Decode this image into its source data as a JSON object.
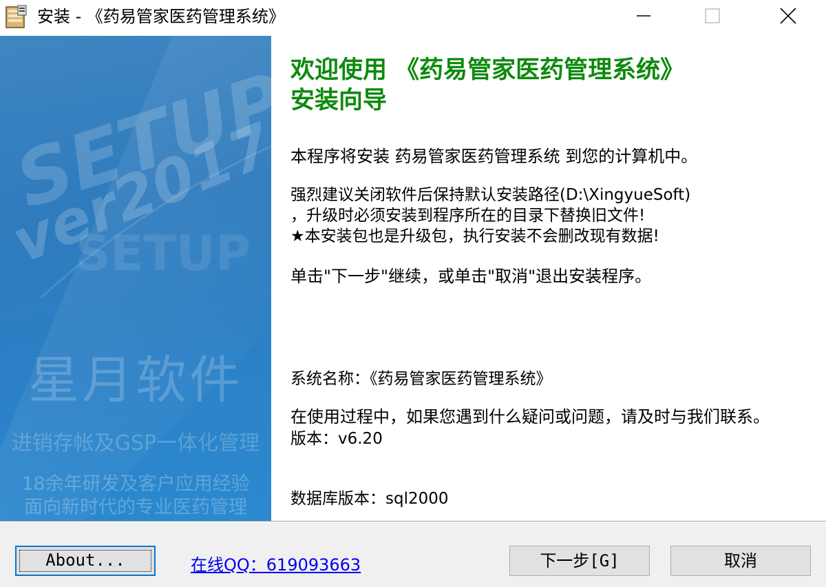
{
  "window": {
    "title": "安装 - 《药易管家医药管理系统》",
    "icon": "installer-box-icon",
    "controls": {
      "minimize": "minimize-icon",
      "maximize": "maximize-icon",
      "close": "close-icon"
    }
  },
  "banner": {
    "setup_text": "SETUP",
    "version_text": "ver2017",
    "setup_shadow_text": "SETUP",
    "brand": "星月软件",
    "tagline": "进销存帐及GSP一体化管理",
    "line1": "18余年研发及客户应用经验",
    "line2": "面向新时代的专业医药管理"
  },
  "content": {
    "welcome_line1": "欢迎使用 《药易管家医药管理系统》",
    "welcome_line2": "安装向导",
    "paragraph1": "本程序将安装 药易管家医药管理系统 到您的计算机中。",
    "paragraph2": "强烈建议关闭软件后保持默认安装路径(D:\\XingyueSoft)\n，升级时必须安装到程序所在的目录下替换旧文件!\n★本安装包也是升级包，执行安装不会删改现有数据!",
    "paragraph3": "单击\"下一步\"继续，或单击\"取消\"退出安装程序。",
    "info": {
      "system_name": "系统名称：《药易管家医药管理系统》",
      "version": "版本：v6.20",
      "db_version": "数据库版本：sql2000"
    },
    "paragraph5": "在使用过程中，如果您遇到什么疑问或问题，请及时与我们联系。"
  },
  "footer": {
    "about_label": "About...",
    "qq_link": "在线QQ：619093663",
    "next_label": "下一步[G]",
    "cancel_label": "取消"
  },
  "colors": {
    "welcome_green": "#0e8a0e",
    "banner_blue": "#2f7bbd",
    "link_blue": "#0000ee",
    "focus_blue": "#0078d7"
  }
}
